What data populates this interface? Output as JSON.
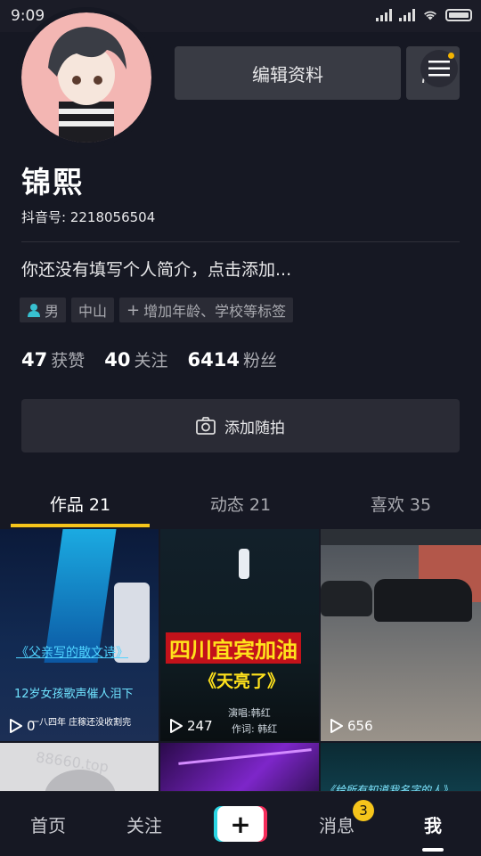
{
  "status_bar": {
    "time": "9:09"
  },
  "profile": {
    "nickname": "锦熙",
    "douyin_id": "抖音号: 2218056504",
    "bio": "你还没有填写个人简介，点击添加...",
    "edit_button": "编辑资料",
    "tags": [
      {
        "icon": "male-icon",
        "label": "男"
      },
      {
        "label": "中山"
      },
      {
        "icon": "plus-icon",
        "label": "增加年龄、学校等标签"
      }
    ],
    "stats": [
      {
        "value": "47",
        "label": "获赞"
      },
      {
        "value": "40",
        "label": "关注"
      },
      {
        "value": "6414",
        "label": "粉丝"
      }
    ],
    "snap_button": "添加随拍"
  },
  "tabs": [
    {
      "label": "作品 21",
      "active": true
    },
    {
      "label": "动态 21",
      "active": false
    },
    {
      "label": "喜欢 35",
      "active": false
    }
  ],
  "videos": [
    {
      "playcount": "0",
      "overlay": [
        "《父亲写的散文诗》",
        "12岁女孩歌声催人泪下",
        "一八四年 庄稼还没收割完"
      ]
    },
    {
      "playcount": "247",
      "overlay": [
        "四川宜宾加油",
        "《天亮了》",
        "演唱:韩红",
        "作词: 韩红"
      ]
    },
    {
      "playcount": "656",
      "overlay": []
    },
    {
      "overlay": [
        "88660.top"
      ]
    },
    {
      "overlay": []
    },
    {
      "overlay": [
        "《给所有知道我名字的人》"
      ]
    }
  ],
  "bottom_nav": {
    "items": [
      "首页",
      "关注",
      "消息",
      "我"
    ],
    "messages_badge": "3"
  },
  "colors": {
    "accent": "#f6c51b",
    "background": "#161823",
    "cyan": "#2cd5e3",
    "pink": "#f42d5b"
  }
}
